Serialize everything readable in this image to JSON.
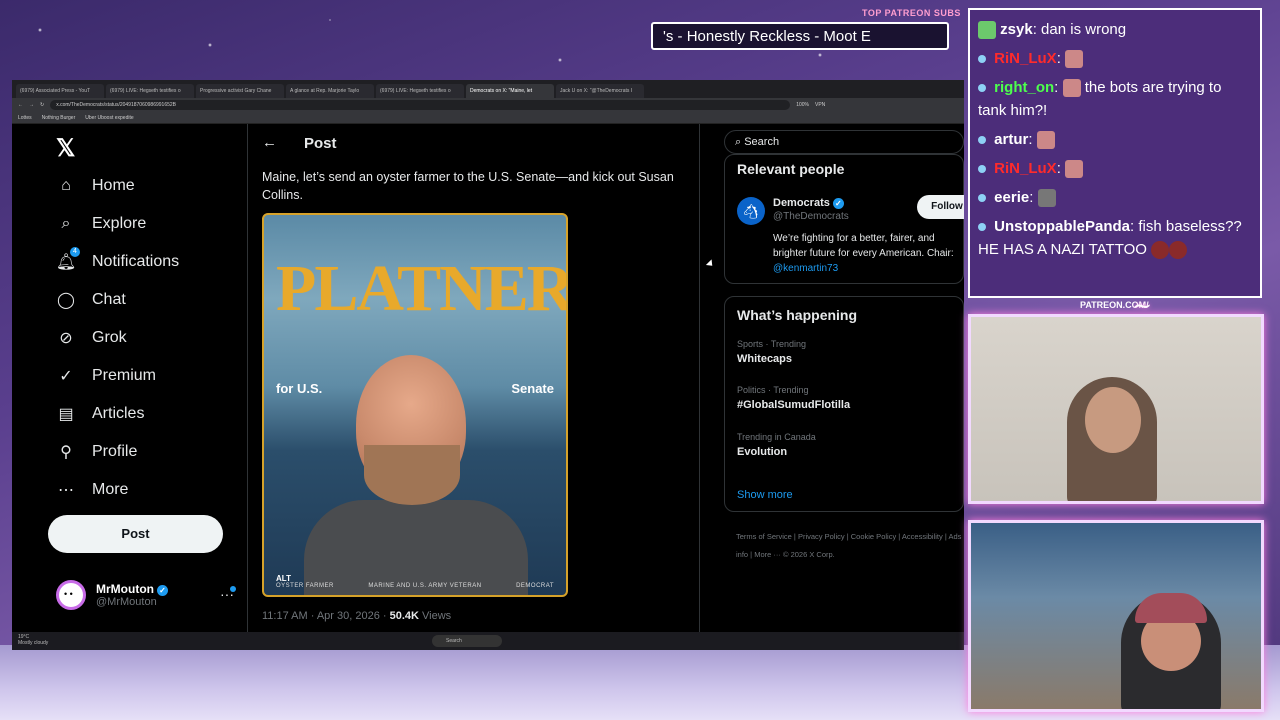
{
  "overlay": {
    "patreon_label": "TOP PATREON SUBS",
    "ticker_text": "'s - Honestly Reckless - Moot E",
    "patreon_url": "PATREON.COM/",
    "signature": "Anything Else"
  },
  "browser": {
    "tabs": [
      "(6979) Associated Press - YouT",
      "(6979) LIVE: Hegseth testifies o",
      "Progressive activist Gary Chane",
      "A glance at Rep. Marjorie Taylo",
      "(6979) LIVE: Hegseth testifies o",
      "Democrats on X: \"Maine, let",
      "Jack U on X: \"@TheDemocrats I"
    ],
    "active_tab_index": 5,
    "url": "x.com/TheDemocrats/status/2049187060986991652B",
    "zoom": "100%",
    "bookmarks": [
      "Lottes",
      "Nothing Burger",
      "Uber Uboost expedite"
    ],
    "vpn_label": "VPN"
  },
  "nav": {
    "items": [
      {
        "label": "Home",
        "icon": "home-icon"
      },
      {
        "label": "Explore",
        "icon": "search-icon"
      },
      {
        "label": "Notifications",
        "icon": "bell-icon",
        "badge": "4"
      },
      {
        "label": "Chat",
        "icon": "chat-icon"
      },
      {
        "label": "Grok",
        "icon": "grok-icon"
      },
      {
        "label": "Premium",
        "icon": "premium-icon"
      },
      {
        "label": "Articles",
        "icon": "articles-icon"
      },
      {
        "label": "Profile",
        "icon": "profile-icon"
      },
      {
        "label": "More",
        "icon": "more-icon"
      }
    ],
    "post_label": "Post",
    "account": {
      "name": "MrMouton",
      "handle": "@MrMouton"
    }
  },
  "main": {
    "header": "Post",
    "text": "Maine, let’s send an oyster farmer to the U.S. Senate—and kick out Susan Collins.",
    "image": {
      "name": "PLATNER",
      "for": "for U.S.",
      "senate": "Senate",
      "alt": "ALT",
      "footer": [
        "OYSTER FARMER",
        "MARINE AND U.S. ARMY VETERAN",
        "DEMOCRAT"
      ]
    },
    "meta_time": "11:17 AM · Apr 30, 2026 ·",
    "meta_views": "50.4K",
    "meta_views_label": "Views"
  },
  "right": {
    "search_placeholder": "Search",
    "relevant_title": "Relevant people",
    "person": {
      "name": "Democrats",
      "handle": "@TheDemocrats",
      "follow_label": "Follow",
      "bio": "We’re fighting for a better, fairer, and brighter future for every American. Chair:",
      "bio_link": "@kenmartin73"
    },
    "happening_title": "What’s happening",
    "trends": [
      {
        "category": "Sports · Trending",
        "name": "Whitecaps"
      },
      {
        "category": "Politics · Trending",
        "name": "#GlobalSumudFlotilla"
      },
      {
        "category": "Trending in Canada",
        "name": "Evolution"
      }
    ],
    "show_more": "Show more",
    "footer": "Terms of Service | Privacy Policy | Cookie Policy | Accessibility | Ads info | More ··· © 2026 X Corp."
  },
  "taskbar": {
    "search": "Search",
    "weather_temp": "19°C",
    "weather_desc": "Mostly cloudy"
  },
  "chat": [
    {
      "user": "zsyk",
      "message": "dan is wrong",
      "color": "#ffffff"
    },
    {
      "user": "RiN_LuX",
      "message": "",
      "color": "#ff2b2b"
    },
    {
      "user": "right_on",
      "message": "the bots are trying to tank him?!",
      "color": "#4dff4d"
    },
    {
      "user": "artur",
      "message": "",
      "color": "#ffffff"
    },
    {
      "user": "RiN_LuX",
      "message": "",
      "color": "#ff2b2b"
    },
    {
      "user": "eerie",
      "message": "",
      "color": "#ffffff"
    },
    {
      "user": "UnstoppablePanda",
      "message": "fish baseless?? HE HAS A NAZI TATTOO",
      "color": "#ffffff"
    }
  ]
}
